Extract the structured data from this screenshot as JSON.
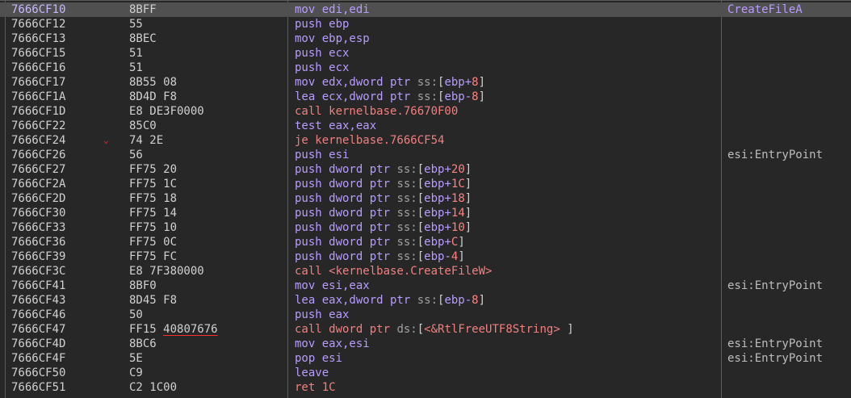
{
  "colors": {
    "background": "#272727",
    "selected_row": "#505050",
    "address": "#d0d0d0",
    "instruction": "#b89cff",
    "call_jump": "#f08080",
    "number": "#ff8080",
    "comment": "#bdbdbd",
    "separator": "#5c5c5c"
  },
  "icons": {
    "branch_arrow": "chevron-down-icon"
  },
  "rows": [
    {
      "address": "7666CF10",
      "bytes": "8BFF",
      "instr": [
        "mov edi,edi"
      ],
      "comment": "CreateFileA",
      "selected": true
    },
    {
      "address": "7666CF12",
      "bytes": "55",
      "instr": [
        "push ebp"
      ]
    },
    {
      "address": "7666CF13",
      "bytes": "8BEC",
      "instr": [
        "mov ebp,esp"
      ]
    },
    {
      "address": "7666CF15",
      "bytes": "51",
      "instr": [
        "push ecx"
      ]
    },
    {
      "address": "7666CF16",
      "bytes": "51",
      "instr": [
        "push ecx"
      ]
    },
    {
      "address": "7666CF17",
      "bytes": "8B55 08",
      "instr": [
        "mov edx,dword ptr ",
        "ss:",
        "[",
        "ebp+",
        "8",
        "]"
      ]
    },
    {
      "address": "7666CF1A",
      "bytes": "8D4D F8",
      "instr": [
        "lea ecx,dword ptr ",
        "ss:",
        "[",
        "ebp-",
        "8",
        "]"
      ]
    },
    {
      "address": "7666CF1D",
      "bytes": "E8 DE3F0000",
      "instr": [
        "call kernelbase.76670F00"
      ],
      "kind": "call"
    },
    {
      "address": "7666CF22",
      "bytes": "85C0",
      "instr": [
        "test eax,eax"
      ]
    },
    {
      "address": "7666CF24",
      "bytes": "74 2E",
      "instr": [
        "je kernelbase.7666CF54"
      ],
      "kind": "jump",
      "arrow": "⌄"
    },
    {
      "address": "7666CF26",
      "bytes": "56",
      "instr": [
        "push esi"
      ],
      "comment": "esi:EntryPoint"
    },
    {
      "address": "7666CF27",
      "bytes": "FF75 20",
      "instr": [
        "push dword ptr ",
        "ss:",
        "[",
        "ebp+",
        "20",
        "]"
      ]
    },
    {
      "address": "7666CF2A",
      "bytes": "FF75 1C",
      "instr": [
        "push dword ptr ",
        "ss:",
        "[",
        "ebp+",
        "1C",
        "]"
      ]
    },
    {
      "address": "7666CF2D",
      "bytes": "FF75 18",
      "instr": [
        "push dword ptr ",
        "ss:",
        "[",
        "ebp+",
        "18",
        "]"
      ]
    },
    {
      "address": "7666CF30",
      "bytes": "FF75 14",
      "instr": [
        "push dword ptr ",
        "ss:",
        "[",
        "ebp+",
        "14",
        "]"
      ]
    },
    {
      "address": "7666CF33",
      "bytes": "FF75 10",
      "instr": [
        "push dword ptr ",
        "ss:",
        "[",
        "ebp+",
        "10",
        "]"
      ]
    },
    {
      "address": "7666CF36",
      "bytes": "FF75 0C",
      "instr": [
        "push dword ptr ",
        "ss:",
        "[",
        "ebp+",
        "C",
        "]"
      ]
    },
    {
      "address": "7666CF39",
      "bytes": "FF75 FC",
      "instr": [
        "push dword ptr ",
        "ss:",
        "[",
        "ebp-",
        "4",
        "]"
      ]
    },
    {
      "address": "7666CF3C",
      "bytes": "E8 7F380000",
      "instr": [
        "call <kernelbase.CreateFileW>"
      ],
      "kind": "call"
    },
    {
      "address": "7666CF41",
      "bytes": "8BF0",
      "instr": [
        "mov esi,eax"
      ],
      "comment": "esi:EntryPoint"
    },
    {
      "address": "7666CF43",
      "bytes": "8D45 F8",
      "instr": [
        "lea eax,dword ptr ",
        "ss:",
        "[",
        "ebp-",
        "8",
        "]"
      ]
    },
    {
      "address": "7666CF46",
      "bytes": "50",
      "instr": [
        "push eax"
      ]
    },
    {
      "address": "7666CF47",
      "bytes": "FF15",
      "bytes_ul": "40807676",
      "instr": [
        "call dword ptr ",
        "ds:",
        "[",
        "<&RtlFreeUTF8String>",
        " ",
        "]"
      ],
      "kind": "call"
    },
    {
      "address": "7666CF4D",
      "bytes": "8BC6",
      "instr": [
        "mov eax,esi"
      ],
      "comment": "esi:EntryPoint"
    },
    {
      "address": "7666CF4F",
      "bytes": "5E",
      "instr": [
        "pop esi"
      ],
      "comment": "esi:EntryPoint"
    },
    {
      "address": "7666CF50",
      "bytes": "C9",
      "instr": [
        "leave"
      ]
    },
    {
      "address": "7666CF51",
      "bytes": "C2 1C00",
      "instr": [
        "ret 1C"
      ],
      "kind": "call"
    }
  ]
}
